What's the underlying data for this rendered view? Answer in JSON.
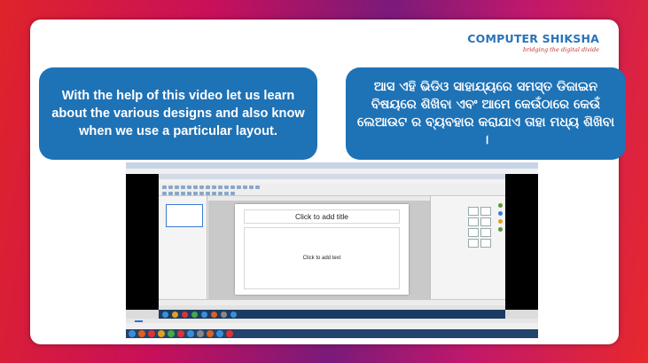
{
  "brand": {
    "name": "COMPUTER SHIKSHA",
    "tagline": "bridging the digital divide"
  },
  "bubbles": {
    "english": "With the help of this video let us learn about the various designs and also know when we use a particular layout.",
    "odia": "ଆସ ଏହି ଭିଡିଓ ସାହାଯ୍ୟରେ ସମସ୍ତ ଡିଜାଇନ ବିଷୟରେ ଶିଖିବା ଏବଂ ଆମେ କେଉଁଠାରେ କେଉଁ ଲେଆଉଟ ର ବ୍ୟବହାର କରାଯାଏ ତାହା ମଧ୍ୟ ଶିଖିବା ।"
  },
  "video": {
    "placeholder_title": "Click to add title",
    "placeholder_text": "Click to add text",
    "seek_progress": 0.02
  },
  "colors": {
    "bubble": "#1e72b6",
    "brand_blue": "#2a73b9",
    "brand_red": "#c23333"
  }
}
